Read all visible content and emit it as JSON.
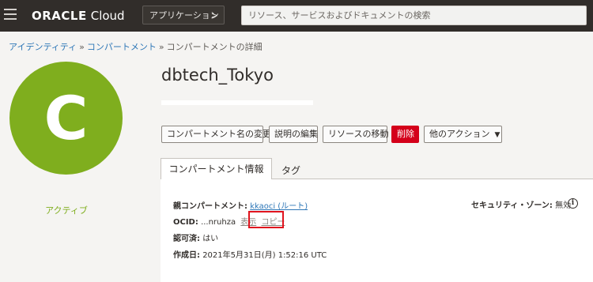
{
  "header": {
    "logo_brand": "ORACLE",
    "logo_product": "Cloud",
    "apps_button_label": "アプリケーション",
    "search_placeholder": "リソース、サービスおよびドキュメントの検索"
  },
  "breadcrumb": {
    "items": [
      "アイデンティティ",
      "コンパートメント",
      "コンパートメントの詳細"
    ],
    "separator": "»"
  },
  "avatar": {
    "letter": "C",
    "color": "#7fae1e",
    "status": "アクティブ"
  },
  "title": "dbtech_Tokyo",
  "actions": {
    "rename": "コンパートメント名の変更",
    "edit_description": "説明の編集",
    "move_resource": "リソースの移動",
    "delete": "削除",
    "more_actions": "他のアクション"
  },
  "tabs": {
    "info": "コンパートメント情報",
    "tags": "タグ"
  },
  "info": {
    "parent_label": "親コンパートメント:",
    "parent_value": "kkaoci (ルート)",
    "ocid_label": "OCID:",
    "ocid_value": "...nruhza",
    "show_link": "表示",
    "copy_link": "コピー",
    "approved_label": "認可済:",
    "approved_value": "はい",
    "created_label": "作成日:",
    "created_value": "2021年5月31日(月) 1:52:16 UTC",
    "security_zone_label": "セキュリティ・ゾーン:",
    "security_zone_value": "無効"
  },
  "colors": {
    "navbar": "#312d2a",
    "accent_link": "#2e77b7",
    "danger": "#d4001a",
    "highlight": "#e0141e"
  }
}
